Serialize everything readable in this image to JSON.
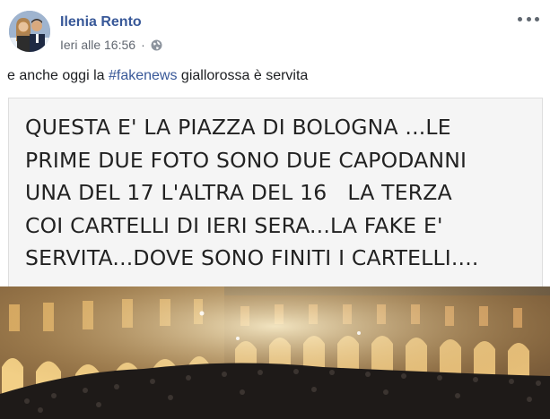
{
  "post": {
    "author": "Ilenia Rento",
    "timestamp": "Ieri alle 16:56",
    "separator": "·",
    "privacy_icon": "globe-icon",
    "menu_icon": "more-options-icon",
    "text_before": "e anche oggi la ",
    "hashtag": "#fakenews",
    "text_after": " giallorossa è servita"
  },
  "image": {
    "caption_lines": [
      "QUESTA E' LA PIAZZA DI BOLOGNA ...LE",
      "PRIME DUE FOTO SONO DUE CAPODANNI",
      "UNA DEL 17 L'ALTRA DEL 16   LA TERZA",
      "COI CARTELLI DI IERI SERA...LA FAKE E'",
      "SERVITA...DOVE SONO FINITI I CARTELLI...."
    ]
  },
  "colors": {
    "link": "#385898",
    "text": "#1c1e21",
    "meta": "#616770"
  }
}
